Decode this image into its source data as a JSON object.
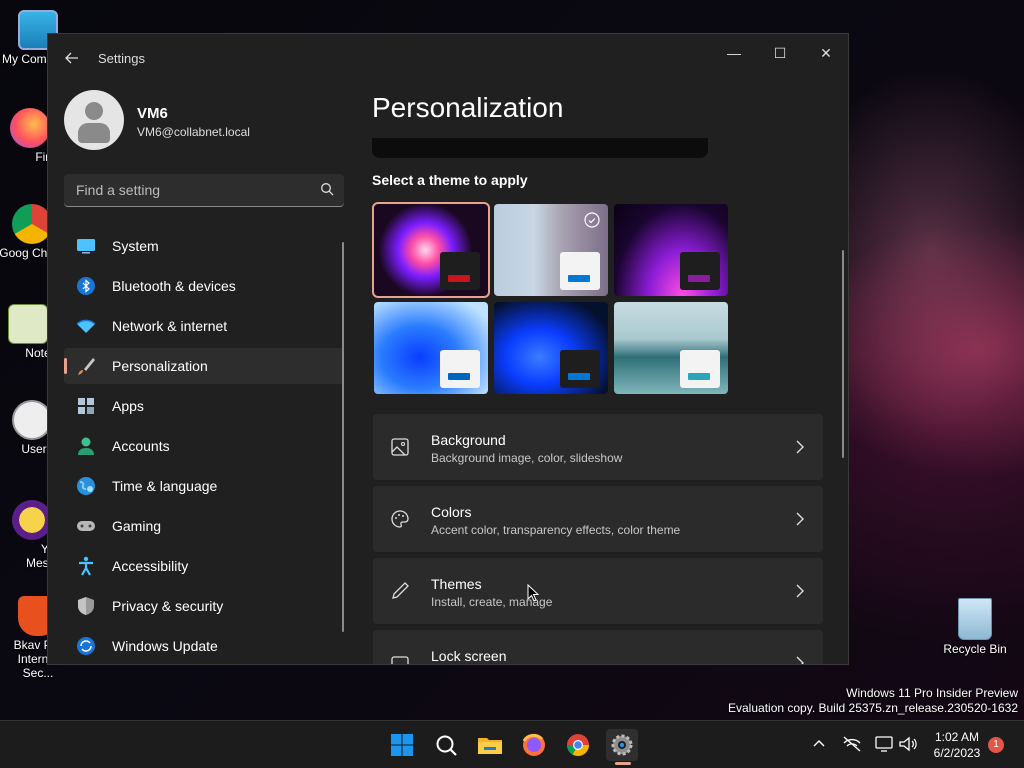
{
  "desktop": {
    "icons": [
      {
        "label": "My Com"
      },
      {
        "label": "Firefo"
      },
      {
        "label": "Goog Chrom"
      },
      {
        "label": "Notepa"
      },
      {
        "label": "UserBen"
      },
      {
        "label": "Yaho Messen"
      },
      {
        "label": "Bkav Pro Internet Sec..."
      }
    ],
    "recycle_bin": "Recycle Bin",
    "watermark": {
      "line1": "Windows 11 Pro Insider Preview",
      "line2": "Evaluation copy. Build 25375.zn_release.230520-1632"
    }
  },
  "window": {
    "title": "Settings",
    "controls": {
      "minimize": "—",
      "maximize": "☐",
      "close": "✕"
    }
  },
  "profile": {
    "name": "VM6",
    "email": "VM6@collabnet.local"
  },
  "search": {
    "placeholder": "Find a setting"
  },
  "nav": {
    "items": [
      {
        "label": "System",
        "icon": "system-icon",
        "active": false
      },
      {
        "label": "Bluetooth & devices",
        "icon": "bluetooth-icon",
        "active": false
      },
      {
        "label": "Network & internet",
        "icon": "wifi-icon",
        "active": false
      },
      {
        "label": "Personalization",
        "icon": "brush-icon",
        "active": true
      },
      {
        "label": "Apps",
        "icon": "apps-icon",
        "active": false
      },
      {
        "label": "Accounts",
        "icon": "accounts-icon",
        "active": false
      },
      {
        "label": "Time & language",
        "icon": "globe-icon",
        "active": false
      },
      {
        "label": "Gaming",
        "icon": "gamepad-icon",
        "active": false
      },
      {
        "label": "Accessibility",
        "icon": "accessibility-icon",
        "active": false
      },
      {
        "label": "Privacy & security",
        "icon": "shield-icon",
        "active": false
      },
      {
        "label": "Windows Update",
        "icon": "update-icon",
        "active": false
      }
    ]
  },
  "main": {
    "title": "Personalization",
    "theme_heading": "Select a theme to apply",
    "themes": [
      {
        "name": "theme-glow-flower",
        "accent": "#c8141e",
        "selected": true
      },
      {
        "name": "theme-flowers-light",
        "accent": "#0078d4",
        "selected": false
      },
      {
        "name": "theme-purple-glow",
        "accent": "#8b1c9e",
        "selected": false
      },
      {
        "name": "theme-windows-light",
        "accent": "#0067c0",
        "selected": false
      },
      {
        "name": "theme-windows-dark",
        "accent": "#0078d4",
        "selected": false
      },
      {
        "name": "theme-lake",
        "accent": "#2aa6b8",
        "selected": false
      }
    ],
    "settings": [
      {
        "title": "Background",
        "subtitle": "Background image, color, slideshow"
      },
      {
        "title": "Colors",
        "subtitle": "Accent color, transparency effects, color theme"
      },
      {
        "title": "Themes",
        "subtitle": "Install, create, manage"
      },
      {
        "title": "Lock screen",
        "subtitle": ""
      }
    ]
  },
  "taskbar": {
    "apps": [
      "start",
      "search",
      "file-explorer",
      "firefox",
      "chrome",
      "settings"
    ],
    "clock": {
      "time": "1:02 AM",
      "date": "6/2/2023"
    },
    "notifications": "1"
  },
  "colors": {
    "accent": "#e8a38e",
    "window_bg": "#202020",
    "card_bg": "#2b2b2b"
  }
}
